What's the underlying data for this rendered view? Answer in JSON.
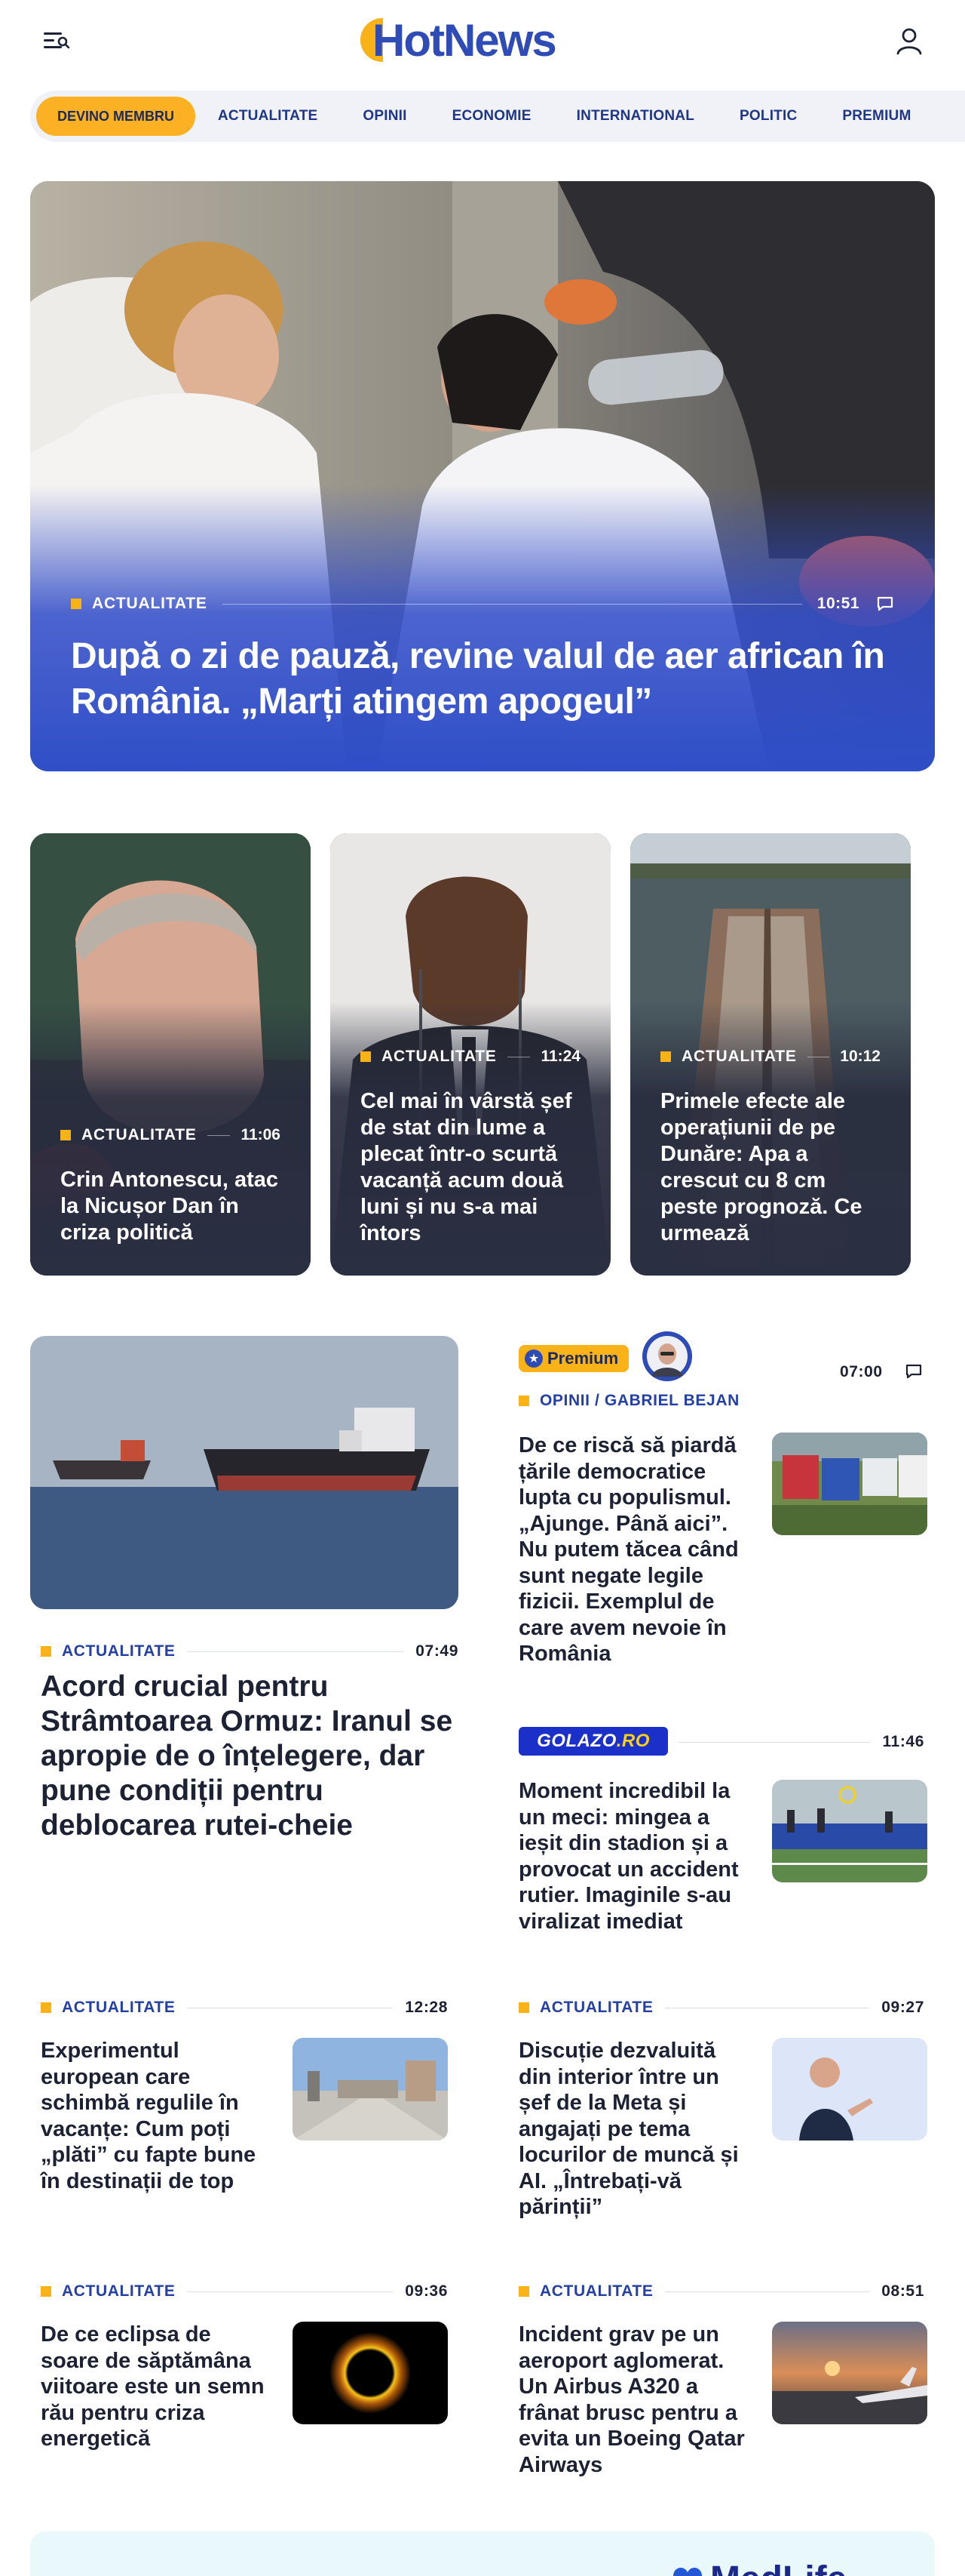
{
  "header": {
    "logo_text": "HotNews",
    "brand_color": "#2f4bb5",
    "accent_color": "#f9b218"
  },
  "nav": {
    "cta": "DEVINO MEMBRU",
    "items": [
      "ACTUALITATE",
      "OPINII",
      "ECONOMIE",
      "INTERNATIONAL",
      "POLITIC",
      "PREMIUM"
    ]
  },
  "hero": {
    "category": "ACTUALITATE",
    "time": "10:51",
    "title": "După o zi de pauză, revine valul de aer african în România. „Marți atingem apogeul”"
  },
  "cards": [
    {
      "category": "ACTUALITATE",
      "time": "11:06",
      "title": "Crin Antonescu, atac la Nicușor Dan în criza politică"
    },
    {
      "category": "ACTUALITATE",
      "time": "11:24",
      "title": "Cel mai în vârstă șef de stat din lume a plecat într-o scurtă vacanță acum două luni și nu s-a mai întors"
    },
    {
      "category": "ACTUALITATE",
      "time": "10:12",
      "title": "Primele efecte ale operațiunii de pe Dunăre: Apa a crescut cu 8 cm peste prognoză. Ce urmează"
    }
  ],
  "main_story": {
    "category": "ACTUALITATE",
    "time": "07:49",
    "title": "Acord crucial pentru Strâmtoarea Ormuz: Iranul se apropie de o înțelegere, dar pune condiții pentru deblocarea rutei-cheie"
  },
  "opinion": {
    "badge": "Premium",
    "time": "07:00",
    "category": "OPINII / GABRIEL BEJAN",
    "title": "De ce riscă să piardă țările democratice lupta cu populismul. „Ajunge. Până aici”. Nu putem tăcea când sunt negate legile fizicii. Exemplul de care avem nevoie în România"
  },
  "golazo": {
    "brand_main": "GOLAZO",
    "brand_suffix": ".RO",
    "time": "11:46",
    "title": "Moment incredibil la un meci: mingea a ieșit din stadion și a provocat un accident rutier. Imaginile s-au viralizat imediat"
  },
  "articles": [
    {
      "category": "ACTUALITATE",
      "time": "12:28",
      "title": "Experimentul european care schimbă regulile în vacanțe: Cum poți „plăti” cu fapte bune în destinații de top"
    },
    {
      "category": "ACTUALITATE",
      "time": "09:27",
      "title": "Discuție dezvaluită din interior între un șef de la Meta și angajați pe tema locurilor de muncă și AI. „Întrebați-vă părinții”"
    },
    {
      "category": "ACTUALITATE",
      "time": "09:36",
      "title": "De ce eclipsa de soare de săptămâna viitoare este un semn rău pentru criza energetică"
    },
    {
      "category": "ACTUALITATE",
      "time": "08:51",
      "title": "Incident grav pe un aeroport aglomerat. Un Airbus A320 a frânat brusc pentru a evita un Boeing Qatar Airways"
    }
  ],
  "promo": {
    "left_text": "",
    "right_text": "MedLife"
  }
}
